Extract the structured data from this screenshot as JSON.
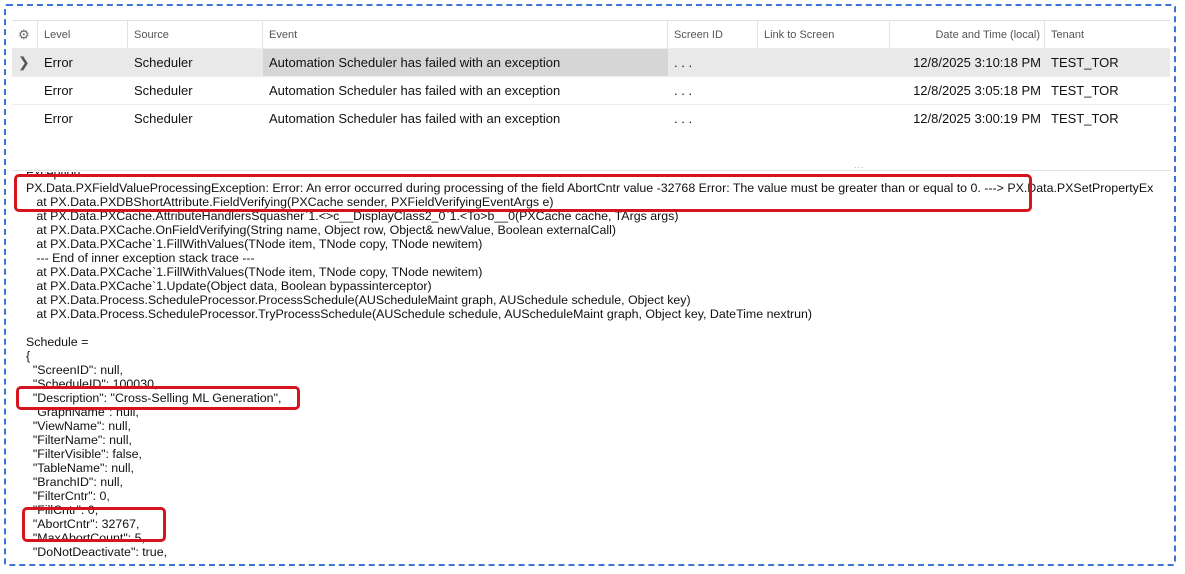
{
  "grid": {
    "columns": {
      "level": "Level",
      "source": "Source",
      "event": "Event",
      "screen_id": "Screen ID",
      "link_to_screen": "Link to Screen",
      "date_time": "Date and Time (local)",
      "tenant": "Tenant"
    },
    "rows": [
      {
        "level": "Error",
        "source": "Scheduler",
        "event": "Automation Scheduler has failed with an exception",
        "screen_id": ". . .",
        "date_time": "12/8/2025 3:10:18 PM",
        "tenant": "TEST_TOR"
      },
      {
        "level": "Error",
        "source": "Scheduler",
        "event": "Automation Scheduler has failed with an exception",
        "screen_id": ". . .",
        "date_time": "12/8/2025 3:05:18 PM",
        "tenant": "TEST_TOR"
      },
      {
        "level": "Error",
        "source": "Scheduler",
        "event": "Automation Scheduler has failed with an exception",
        "screen_id": ". . .",
        "date_time": "12/8/2025 3:00:19 PM",
        "tenant": "TEST_TOR"
      }
    ]
  },
  "splitter": {
    "dots": "..."
  },
  "details": {
    "lines": [
      "Exception:",
      "PX.Data.PXFieldValueProcessingException: Error: An error occurred during processing of the field AbortCntr value -32768 Error: The value must be greater than or equal to 0. ---> PX.Data.PXSetPropertyEx",
      "   at PX.Data.PXDBShortAttribute.FieldVerifying(PXCache sender, PXFieldVerifyingEventArgs e)",
      "   at PX.Data.PXCache.AttributeHandlersSquasher`1.<>c__DisplayClass2_0`1.<To>b__0(PXCache cache, TArgs args)",
      "   at PX.Data.PXCache.OnFieldVerifying(String name, Object row, Object& newValue, Boolean externalCall)",
      "   at PX.Data.PXCache`1.FillWithValues(TNode item, TNode copy, TNode newitem)",
      "   --- End of inner exception stack trace ---",
      "   at PX.Data.PXCache`1.FillWithValues(TNode item, TNode copy, TNode newitem)",
      "   at PX.Data.PXCache`1.Update(Object data, Boolean bypassinterceptor)",
      "   at PX.Data.Process.ScheduleProcessor.ProcessSchedule(AUScheduleMaint graph, AUSchedule schedule, Object key)",
      "   at PX.Data.Process.ScheduleProcessor.TryProcessSchedule(AUSchedule schedule, AUScheduleMaint graph, Object key, DateTime nextrun)",
      "",
      "Schedule =",
      "{",
      "  \"ScreenID\": null,",
      "  \"ScheduleID\": 100030,",
      "  \"Description\": \"Cross-Selling ML Generation\",",
      "  \"GraphName\": null,",
      "  \"ViewName\": null,",
      "  \"FilterName\": null,",
      "  \"FilterVisible\": false,",
      "  \"TableName\": null,",
      "  \"BranchID\": null,",
      "  \"FilterCntr\": 0,",
      "  \"FillCntr\": 0,",
      "  \"AbortCntr\": 32767,",
      "  \"MaxAbortCount\": 5,",
      "  \"DoNotDeactivate\": true,"
    ]
  }
}
